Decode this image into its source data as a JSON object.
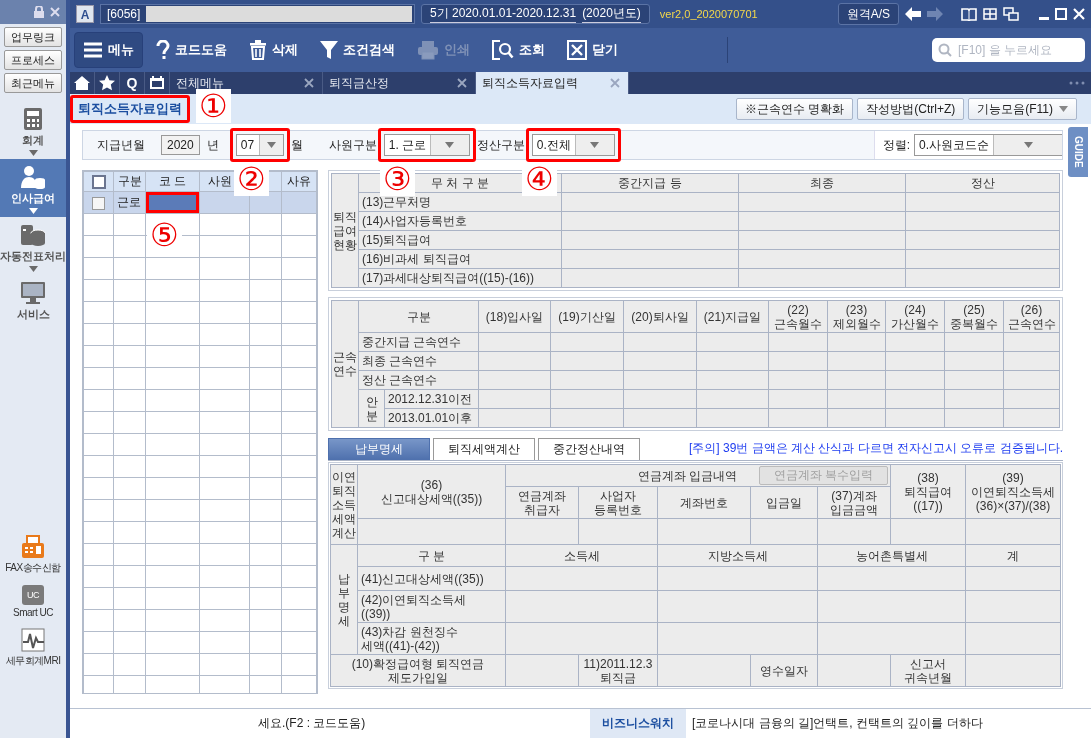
{
  "sidebar": {
    "quick_buttons": [
      "업무링크",
      "프로세스",
      "최근메뉴"
    ],
    "nav": [
      {
        "label": "회계",
        "selected": false,
        "submenu": true
      },
      {
        "label": "인사급여",
        "selected": true,
        "submenu": true
      },
      {
        "label": "자동전표처리",
        "selected": false,
        "submenu": true
      },
      {
        "label": "서비스",
        "selected": false,
        "submenu": false
      }
    ],
    "tools": [
      {
        "label": "FAX송수신함"
      },
      {
        "label": "Smart UC",
        "icon_text": "UC"
      },
      {
        "label": "세무회계MRI"
      }
    ]
  },
  "title_bar": {
    "app_badge": "A",
    "company": "[6056]",
    "period": "5기  2020.01.01-2020.12.31",
    "fiscal_year": "(2020년도)",
    "version": "ver2,0_2020070701",
    "remote_button": "원격A/S"
  },
  "toolbar": {
    "buttons": [
      {
        "label": "메뉴",
        "disabled": false
      },
      {
        "label": "코드도움",
        "disabled": false
      },
      {
        "label": "삭제",
        "disabled": false
      },
      {
        "label": "조건검색",
        "disabled": false
      },
      {
        "label": "인쇄",
        "disabled": true
      },
      {
        "label": "조회",
        "disabled": false
      },
      {
        "label": "닫기",
        "disabled": false
      }
    ],
    "search": {
      "placeholder": "[F10] 을 누르세요"
    }
  },
  "tabs": {
    "quick": "Q",
    "items": [
      {
        "label": "전체메뉴",
        "selected": false
      },
      {
        "label": "퇴직금산정",
        "selected": false
      },
      {
        "label": "퇴직소득자료입력",
        "selected": true
      }
    ]
  },
  "page": {
    "title": "퇴직소득자료입력",
    "callout": "①",
    "actions": [
      "※근속연수 명확화",
      "작성방법(Ctrl+Z)",
      "기능모음(F11)"
    ],
    "guide_tab": "GUIDE"
  },
  "filters": {
    "pay_month_label": "지급년월",
    "year": "2020",
    "year_unit": "년",
    "month": {
      "value": "07",
      "callout": "②"
    },
    "month_unit": "월",
    "employee_type": {
      "label": "사원구분",
      "value": "1. 근로",
      "callout": "③"
    },
    "settlement_type": {
      "label": "정산구분",
      "value": "0.전체",
      "callout": "④"
    },
    "sort": {
      "label": "정렬:",
      "value": "0.사원코드순"
    }
  },
  "employee_grid": {
    "all_checked": false,
    "columns": [
      "구분",
      "코 드",
      "사원",
      "사유"
    ],
    "rows": [
      {
        "type": "근로",
        "checked": false,
        "selected": true,
        "callout": "⑤"
      }
    ]
  },
  "retirement_pay": {
    "side_label": "퇴직급여현황",
    "header": "무 처 구 분",
    "columns": [
      "중간지급 등",
      "최종",
      "정산"
    ],
    "rows": [
      "(13)근무처명",
      "(14)사업자등록번호",
      "(15)퇴직급여",
      "(16)비과세 퇴직급여",
      "(17)과세대상퇴직급여((15)-(16))"
    ]
  },
  "service_years": {
    "side_label": "근속연수",
    "header": "구분",
    "columns": [
      "(18)입사일",
      "(19)기산일",
      "(20)퇴사일",
      "(21)지급일",
      "(22)\n근속월수",
      "(23)\n제외월수",
      "(24)\n가산월수",
      "(25)\n중복월수",
      "(26)\n근속연수"
    ],
    "rows": [
      "중간지급 근속연수",
      "최종 근속연수",
      "정산 근속연수"
    ],
    "apportion": {
      "label": "안분",
      "rows": [
        "2012.12.31이전",
        "2013.01.01이후"
      ]
    }
  },
  "payment": {
    "tabs": [
      {
        "label": "납부명세",
        "selected": true
      },
      {
        "label": "퇴직세액계산",
        "selected": false
      },
      {
        "label": "중간정산내역",
        "selected": false
      }
    ],
    "notice": "[주의] 39번 금액은 계산 산식과 다르면 전자신고시 오류로 검증됩니다.",
    "deferred": {
      "side_label": "이연퇴직소득세액계산",
      "reported_tax": "(36)\n신고대상세액((35))",
      "account_group": "연금계좌 입금내역",
      "multi_button": {
        "label": "연금계좌 복수입력",
        "disabled": true
      },
      "account_columns": [
        "연금계좌\n취급자",
        "사업자\n등록번호",
        "계좌번호",
        "입금일",
        "(37)계좌\n입금금액"
      ],
      "retirement_pay": "(38)\n퇴직급여\n((17))",
      "deferred_tax": "(39)\n이연퇴직소득세\n(36)×(37)/(38)"
    },
    "details": {
      "side_label": "납부명세",
      "columns": [
        "구 분",
        "소득세",
        "지방소득세",
        "농어촌특별세",
        "계"
      ],
      "rows": [
        "(41)신고대상세액((35))",
        "(42)이연퇴직소득세\n((39))",
        "(43)차감 원천징수\n세액((41)-(42))"
      ]
    },
    "footer": {
      "pension_join_date": "(10)확정급여형 퇴직연금\n제도가입일",
      "severance_2011": "11)2011.12.3\n퇴직금",
      "receipt_date": "영수일자",
      "report_month": "신고서\n귀속년월"
    }
  },
  "status_bar": {
    "hint": "세요.(F2 : 코드도움)",
    "news_source": "비즈니스워치",
    "headline": "[코로나시대 금융의 길]언택트, 컨택트의 깊이를 더하다"
  }
}
